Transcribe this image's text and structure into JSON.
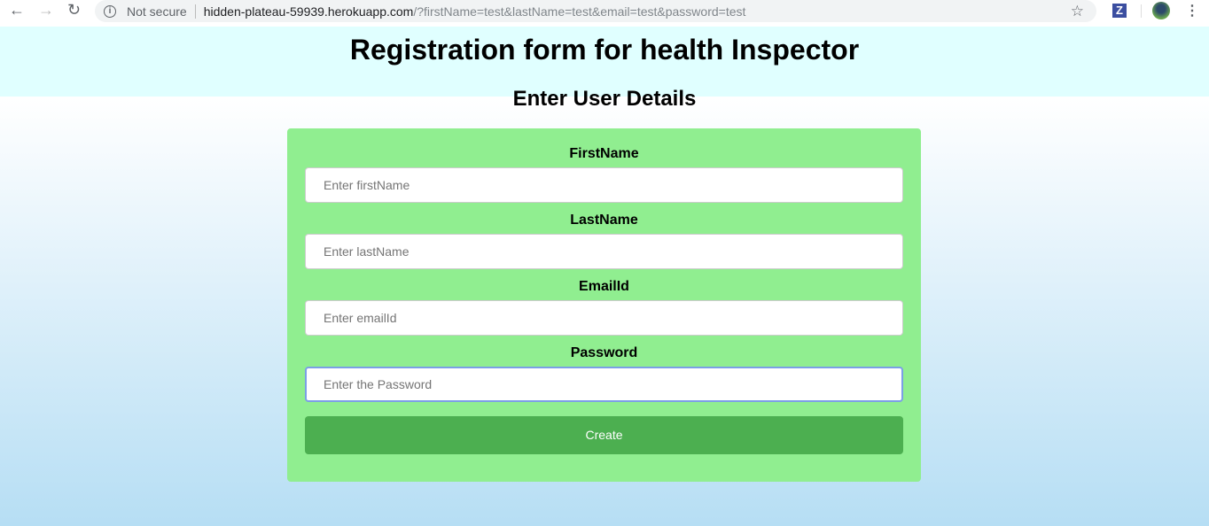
{
  "browser": {
    "security": "Not secure",
    "url_host": "hidden-plateau-59939.herokuapp.com",
    "url_query": "/?firstName=test&lastName=test&email=test&password=test",
    "extension": "Z"
  },
  "page": {
    "title": "Registration form for health Inspector",
    "subtitle": "Enter User Details"
  },
  "form": {
    "fields": [
      {
        "label": "FirstName",
        "placeholder": "Enter firstName"
      },
      {
        "label": "LastName",
        "placeholder": "Enter lastName"
      },
      {
        "label": "EmailId",
        "placeholder": "Enter emailId"
      },
      {
        "label": "Password",
        "placeholder": "Enter the Password"
      }
    ],
    "submit": "Create"
  }
}
